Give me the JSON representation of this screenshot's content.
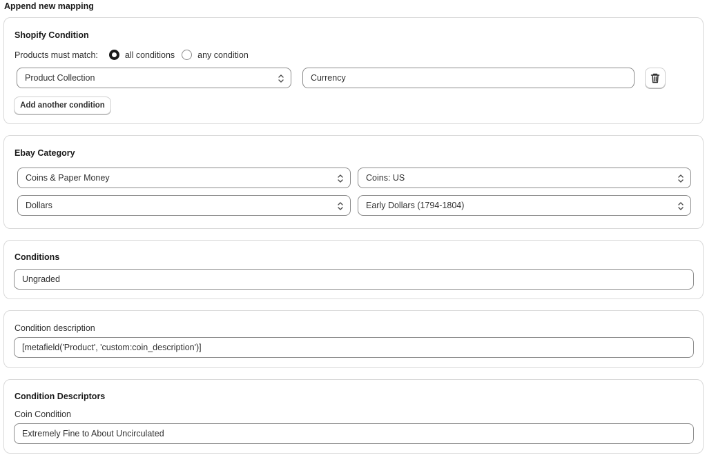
{
  "page": {
    "title": "Append new mapping"
  },
  "shopify_condition": {
    "title": "Shopify Condition",
    "match_label": "Products must match:",
    "match_options": [
      {
        "label": "all conditions",
        "checked": true
      },
      {
        "label": "any condition",
        "checked": false
      }
    ],
    "rows": [
      {
        "field": "Product Collection",
        "value": "Currency"
      }
    ],
    "add_button_label": "Add another condition",
    "delete_icon": "trash-icon"
  },
  "ebay_category": {
    "title": "Ebay Category",
    "selects": [
      "Coins & Paper Money",
      "Coins: US",
      "Dollars",
      "Early Dollars (1794-1804)"
    ]
  },
  "conditions": {
    "title": "Conditions",
    "value": "Ungraded"
  },
  "condition_description": {
    "label": "Condition description",
    "value": "[metafield('Product', 'custom:coin_description')]"
  },
  "condition_descriptors": {
    "title": "Condition Descriptors",
    "field_label": "Coin Condition",
    "value": "Extremely Fine to About Uncirculated"
  }
}
